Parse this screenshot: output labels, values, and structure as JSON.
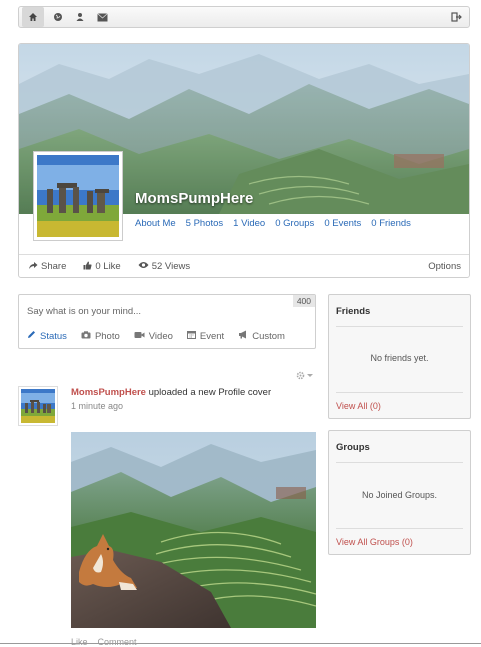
{
  "nav": {
    "items": [
      {
        "icon": "home-icon",
        "glyph": "⌂",
        "active": true
      },
      {
        "icon": "globe-icon",
        "glyph": "◉",
        "active": false
      },
      {
        "icon": "user-icon",
        "glyph": "●",
        "active": false
      },
      {
        "icon": "mail-icon",
        "glyph": "✉",
        "active": false
      }
    ],
    "logout_icon": "logout-icon",
    "logout_glyph": "⇥"
  },
  "profile": {
    "name": "MomsPumpHere",
    "tabs": [
      "About Me",
      "5 Photos",
      "1 Video",
      "0 Groups",
      "0 Events",
      "0 Friends"
    ],
    "actions": {
      "share": "Share",
      "like": "0 Like",
      "views": "52 Views",
      "options": "Options"
    }
  },
  "composer": {
    "placeholder": "Say what is on your mind...",
    "char_count": "400",
    "tabs": [
      {
        "label": "Status",
        "icon": "pencil-icon",
        "glyph": "✎",
        "active": true
      },
      {
        "label": "Photo",
        "icon": "camera-icon",
        "glyph": "▣",
        "active": false
      },
      {
        "label": "Video",
        "icon": "video-icon",
        "glyph": "▶",
        "active": false
      },
      {
        "label": "Event",
        "icon": "calendar-icon",
        "glyph": "▦",
        "active": false
      },
      {
        "label": "Custom",
        "icon": "bullhorn-icon",
        "glyph": "◀",
        "active": false
      }
    ]
  },
  "friends_widget": {
    "title": "Friends",
    "empty": "No friends yet.",
    "link": "View All (0)"
  },
  "groups_widget": {
    "title": "Groups",
    "empty": "No Joined Groups.",
    "link": "View All Groups (0)"
  },
  "feed": {
    "user": "MomsPumpHere",
    "action": " uploaded a new Profile cover",
    "time": "1 minute ago",
    "gear_glyph": "⚙▾",
    "like": "Like",
    "comment": "Comment"
  },
  "colors": {
    "link_blue": "#2a6ab7",
    "accent_red": "#c0504d"
  }
}
